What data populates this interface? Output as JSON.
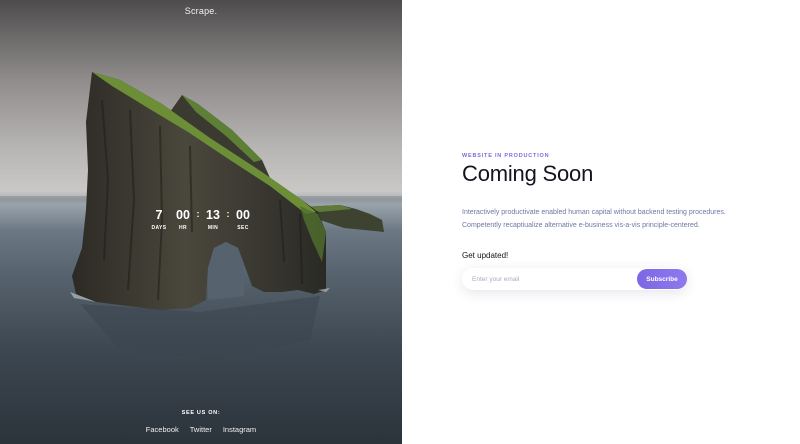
{
  "brand": {
    "logo_text": "Scrape."
  },
  "countdown": {
    "days": {
      "value": "7",
      "label": "DAYS"
    },
    "hours": {
      "value": "00",
      "label": "HR"
    },
    "minutes": {
      "value": "13",
      "label": "MIN"
    },
    "seconds": {
      "value": "00",
      "label": "SEC"
    },
    "separator": ":"
  },
  "social": {
    "heading": "SEE US ON:",
    "links": [
      "Facebook",
      "Twitter",
      "Instagram"
    ]
  },
  "main": {
    "eyebrow": "WEBSITE IN PRODUCTION",
    "title": "Coming Soon",
    "description": [
      "Interactively productivate enabled human capital without backend testing procedures.",
      "Competently recaptiualize alternative e-business vis-a-vis principle-centered."
    ],
    "subscribe_heading": "Get updated!",
    "email_placeholder": "Enter your email",
    "subscribe_label": "Subscribe"
  },
  "colors": {
    "accent": "#7b6ae0",
    "button": "#8272e8",
    "heading": "#14141f",
    "body_text": "#6d78a6"
  }
}
